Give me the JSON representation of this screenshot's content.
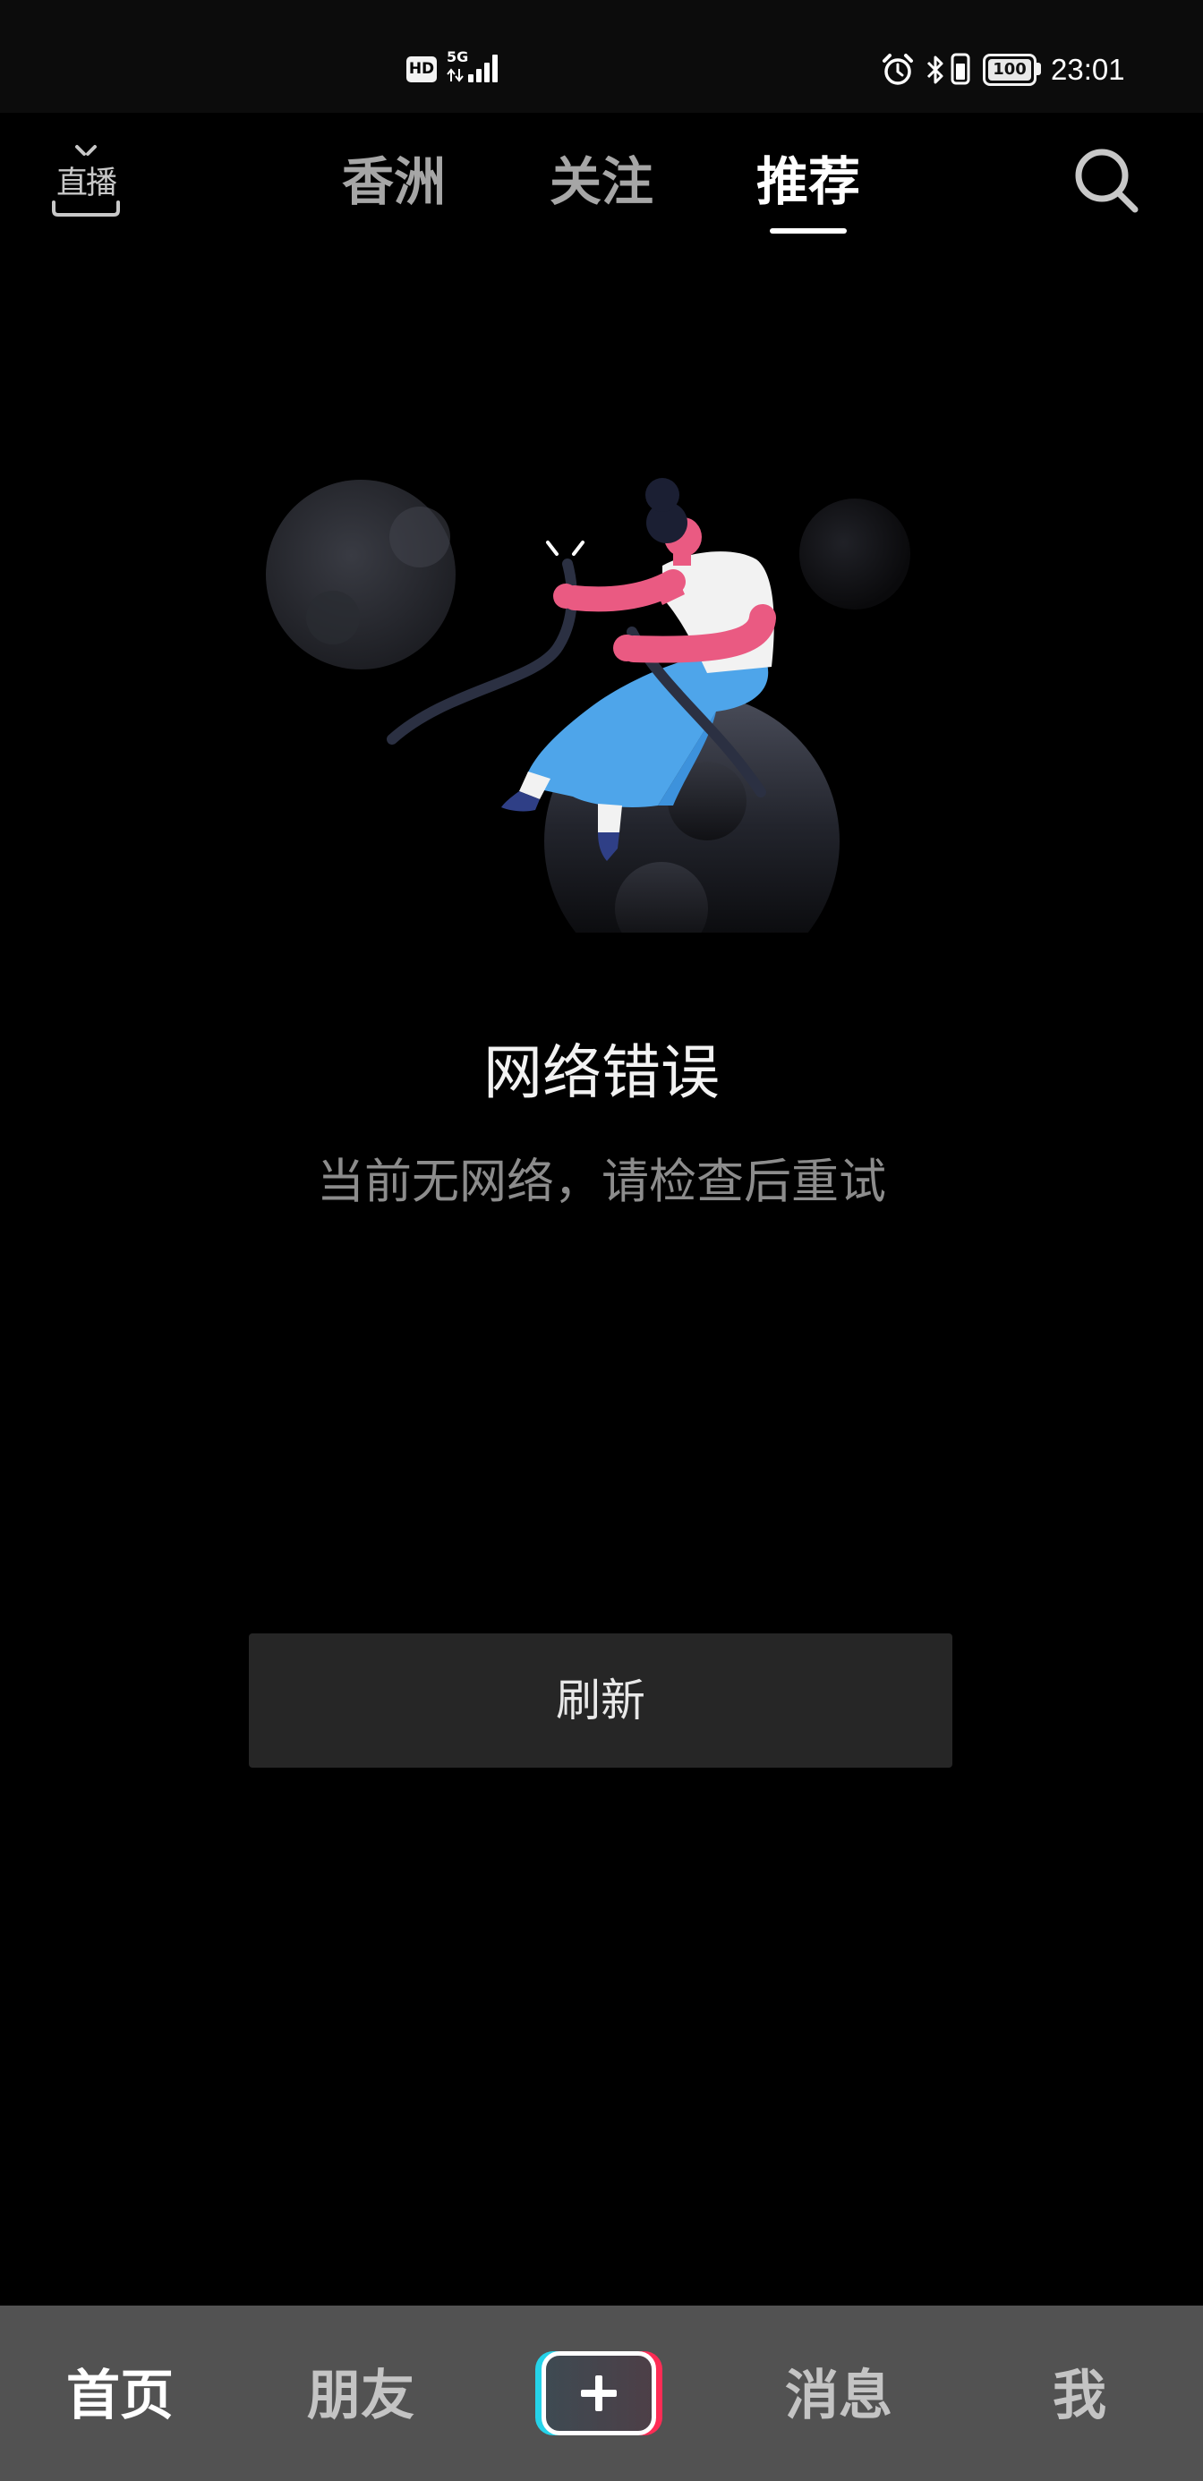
{
  "status_bar": {
    "hd_badge": "HD",
    "network_type": "5G",
    "battery_level": "100",
    "time": "23:01",
    "icons": {
      "data_activity": "data-activity-icon",
      "signal": "signal-strength-icon",
      "alarm": "alarm-icon",
      "bluetooth": "bluetooth-icon",
      "vibrate": "vibrate-icon",
      "battery": "battery-icon"
    }
  },
  "top_nav": {
    "live_label": "直播",
    "live_icon": "live-tv-icon",
    "tabs": [
      {
        "label": "香洲",
        "active": false
      },
      {
        "label": "关注",
        "active": false
      },
      {
        "label": "推荐",
        "active": true
      }
    ],
    "search_icon": "search-icon"
  },
  "error_state": {
    "illustration": "network-error-illustration",
    "title": "网络错误",
    "message": "当前无网络，请检查后重试",
    "refresh_label": "刷新"
  },
  "bottom_nav": {
    "items": [
      {
        "label": "首页",
        "active": true
      },
      {
        "label": "朋友",
        "active": false
      },
      {
        "icon": "plus-icon"
      },
      {
        "label": "消息",
        "active": false
      },
      {
        "label": "我",
        "active": false
      }
    ]
  },
  "colors": {
    "background": "#000000",
    "status_bar": "#0c0c0c",
    "bottom_nav": "#525252",
    "button": "#262626",
    "accent_cyan": "#25d3e9",
    "accent_red": "#fe2c55",
    "text_primary": "#ffffff",
    "text_secondary": "#8c8c8c"
  }
}
